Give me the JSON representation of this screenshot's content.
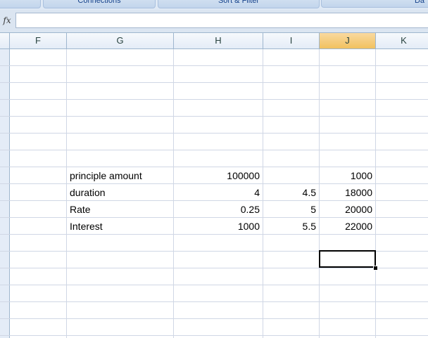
{
  "ribbon": {
    "groups": [
      "",
      "Connections",
      "Sort & Filter",
      "Da"
    ]
  },
  "formula_bar": {
    "fx_label": "fx",
    "value": ""
  },
  "columns": [
    "F",
    "G",
    "H",
    "I",
    "J",
    "K"
  ],
  "selected_column": "J",
  "sheet": {
    "rows": [
      {
        "G": "principle amount",
        "H": "100000",
        "I": "",
        "J": "1000"
      },
      {
        "G": "duration",
        "H": "4",
        "I": "4.5",
        "J": "18000"
      },
      {
        "G": "Rate",
        "H": "0.25",
        "I": "5",
        "J": "20000"
      },
      {
        "G": "Interest",
        "H": "1000",
        "I": "5.5",
        "J": "22000"
      }
    ]
  },
  "active_cell": {
    "column": "J",
    "value": ""
  }
}
